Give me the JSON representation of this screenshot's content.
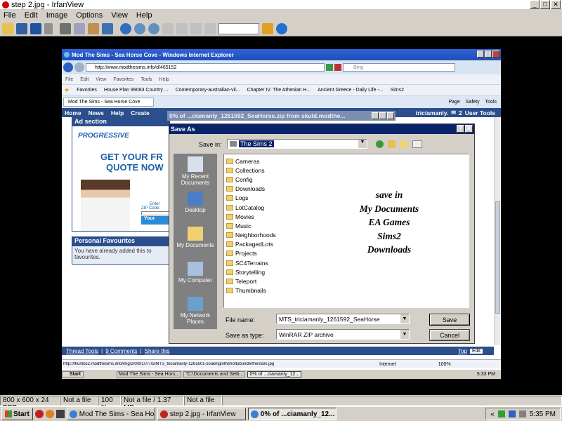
{
  "irfan": {
    "title": "step 2.jpg - IrfanView",
    "menu": [
      "File",
      "Edit",
      "Image",
      "Options",
      "View",
      "Help"
    ],
    "status": [
      "800 x 600 x 24 BPP",
      "Not a file",
      "100 %",
      "Not a file / 1.37 MB",
      "Not a file"
    ]
  },
  "ie": {
    "title": "Mod The Sims - Sea Horse Cove - Windows Internet Explorer",
    "url": "http://www.modthesims.info/d/465152",
    "search_placeholder": "Bing",
    "menu": [
      "File",
      "Edit",
      "View",
      "Favorites",
      "Tools",
      "Help"
    ],
    "favorites_label": "Favorites",
    "favorites": [
      "House Plan 99083 Country ...",
      "Contemporary-australian-vil...",
      "Chapter IV. The Athenian H...",
      "Ancient Greece - Daily Life -...",
      "Sims2"
    ],
    "tab": "Mod The Sims - Sea Horse Cove",
    "cmd": [
      "Page",
      "Safety",
      "Tools"
    ],
    "nav": [
      "Home",
      "News",
      "Help",
      "Create"
    ],
    "nav_right": "triciamanly.",
    "nav_count": "2",
    "user_tools": "User Tools",
    "status_url": "http://thumbs2.modthesims.info/img/2/0/9/1/7/7/5/MTS_triciamanly-1261601-soakinginthehottubunderthestars.jpg",
    "zone": "Internet",
    "zoom": "100%",
    "top": "Top",
    "edit": "Edit",
    "thread_tools": "Thread Tools",
    "comments": "9 Comments",
    "share": "Share this"
  },
  "ad": {
    "header": "Ad section",
    "brand": "PROGRESSIVE",
    "headline1": "GET YOUR FR",
    "headline2": "QUOTE NOW",
    "enter": "Enter",
    "zip": "ZIP Code:",
    "your": "Your"
  },
  "fav": {
    "title": "Personal Favourites",
    "text1": "You have already added this to",
    "text2": "favourites."
  },
  "download": {
    "title": "0% of ...ciamanly_1261592_SeaHorse.zip from skuld.modthe..."
  },
  "save": {
    "title": "Save As",
    "save_in_label": "Save in:",
    "save_in": "The Sims 2",
    "places": [
      "My Recent Documents",
      "Desktop",
      "My Documents",
      "My Computer",
      "My Network Places"
    ],
    "folders": [
      "Cameras",
      "Collections",
      "Config",
      "Downloads",
      "Logs",
      "LotCatalog",
      "Movies",
      "Music",
      "Neighborhoods",
      "PackagedLots",
      "Projects",
      "SC4Terrains",
      "Storytelling",
      "Teleport",
      "Thumbnails"
    ],
    "note": [
      "save in",
      "My Documents",
      "EA Games",
      "Sims2",
      "Downloads"
    ],
    "filename_label": "File name:",
    "filename": "MTS_triciamanly_1261592_SeaHorse",
    "type_label": "Save as type:",
    "type": "WinRAR ZIP archive",
    "save_btn": "Save",
    "cancel_btn": "Cancel"
  },
  "inner_taskbar": {
    "start": "Start",
    "items": [
      "Mod The Sims - Sea Hors...",
      "\"C:\\Documents and Setti...",
      "0% of ...ciamanly_12..."
    ],
    "time": "5:33 PM"
  },
  "taskbar": {
    "start": "Start",
    "items": [
      "Mod The Sims - Sea Hors...",
      "step 2.jpg - IrfanView",
      "0% of ...ciamanly_12..."
    ],
    "time": "5:35 PM"
  },
  "colors": {
    "xp_blue": "#0a246a",
    "ie_nav": "#2b4e8c",
    "progressive_blue": "#1b5fa8"
  }
}
